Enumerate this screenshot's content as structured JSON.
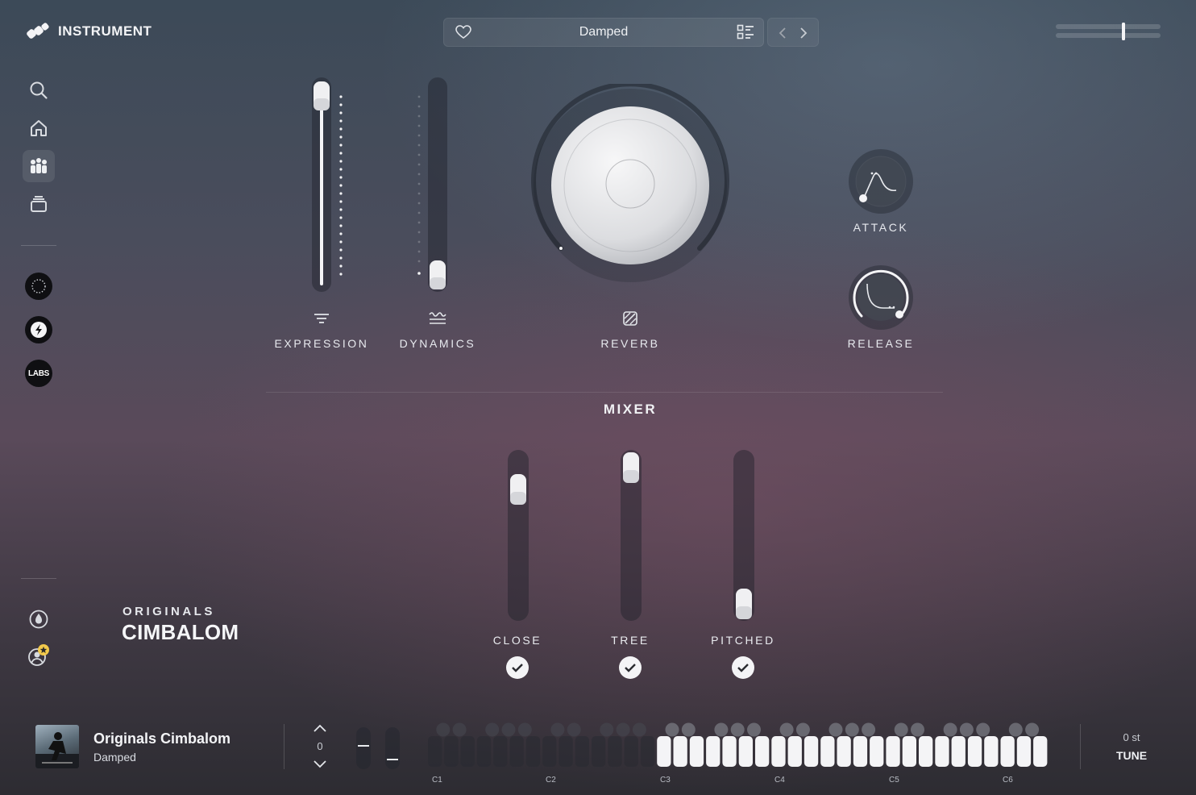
{
  "app": {
    "brand": "INSTRUMENT"
  },
  "header": {
    "preset_name": "Damped"
  },
  "sidebar": {
    "items": [
      {
        "name": "search"
      },
      {
        "name": "home"
      },
      {
        "name": "instruments",
        "active": true
      },
      {
        "name": "library"
      }
    ],
    "brand_items": [
      "circle-brand",
      "spitfire",
      "labs"
    ],
    "labs_label": "LABS"
  },
  "controls": {
    "expression": {
      "label": "EXPRESSION",
      "value": 0.93
    },
    "dynamics": {
      "label": "DYNAMICS",
      "value": 0.05
    },
    "reverb": {
      "label": "REVERB",
      "value": 0.78
    },
    "attack": {
      "label": "ATTACK",
      "value": 0.0
    },
    "release": {
      "label": "RELEASE",
      "value": 1.0
    }
  },
  "mixer": {
    "title": "MIXER",
    "channels": [
      {
        "label": "CLOSE",
        "level": 0.84,
        "enabled": true
      },
      {
        "label": "TREE",
        "level": 0.97,
        "enabled": true
      },
      {
        "label": "PITCHED",
        "level": 0.08,
        "enabled": true
      }
    ]
  },
  "instrument": {
    "series": "ORIGINALS",
    "name": "CIMBALOM"
  },
  "now_playing": {
    "title": "Originals Cimbalom",
    "subtitle": "Damped"
  },
  "bottom": {
    "octave": "0",
    "tune_value": "0 st",
    "tune_label": "TUNE",
    "key_labels": [
      "C1",
      "C2",
      "C3",
      "C4",
      "C5",
      "C6"
    ]
  },
  "colors": {
    "accent_white": "#f4f4f6",
    "track_dark": "#2f3139"
  }
}
